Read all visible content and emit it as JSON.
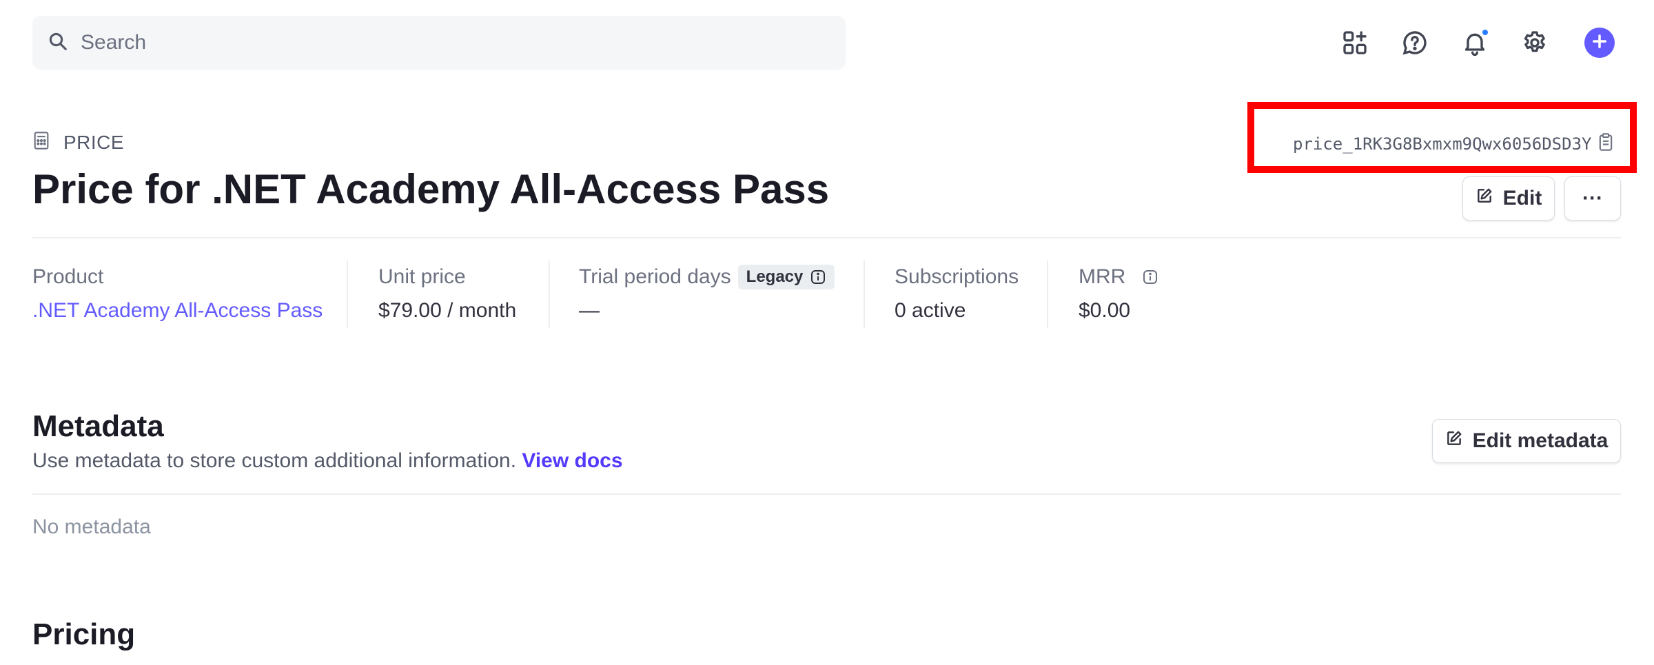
{
  "search": {
    "placeholder": "Search"
  },
  "topbar": {
    "icons": [
      "apps-add-icon",
      "help-icon",
      "bell-icon",
      "gear-icon",
      "plus-icon"
    ],
    "notification_dot_color": "#2b7fff",
    "accent_color": "#635bff"
  },
  "header": {
    "type_label": "PRICE",
    "price_id": "price_1RK3G8Bxmxm9Qwx6056DSD3Y",
    "title": "Price for .NET Academy All-Access Pass",
    "edit_label": "Edit",
    "more_label": "···",
    "highlight_color": "#ff0000"
  },
  "summary": {
    "product_label": "Product",
    "product_value": ".NET Academy All-Access Pass",
    "unit_price_label": "Unit price",
    "unit_price_value": "$79.00 / month",
    "trial_label": "Trial period days",
    "trial_badge": "Legacy",
    "trial_value": "—",
    "subscriptions_label": "Subscriptions",
    "subscriptions_value": "0 active",
    "mrr_label": "MRR",
    "mrr_value": "$0.00"
  },
  "metadata": {
    "title": "Metadata",
    "description": "Use metadata to store custom additional information.",
    "docs_link": "View docs",
    "edit_label": "Edit metadata",
    "empty_text": "No metadata"
  },
  "pricing": {
    "title": "Pricing"
  }
}
